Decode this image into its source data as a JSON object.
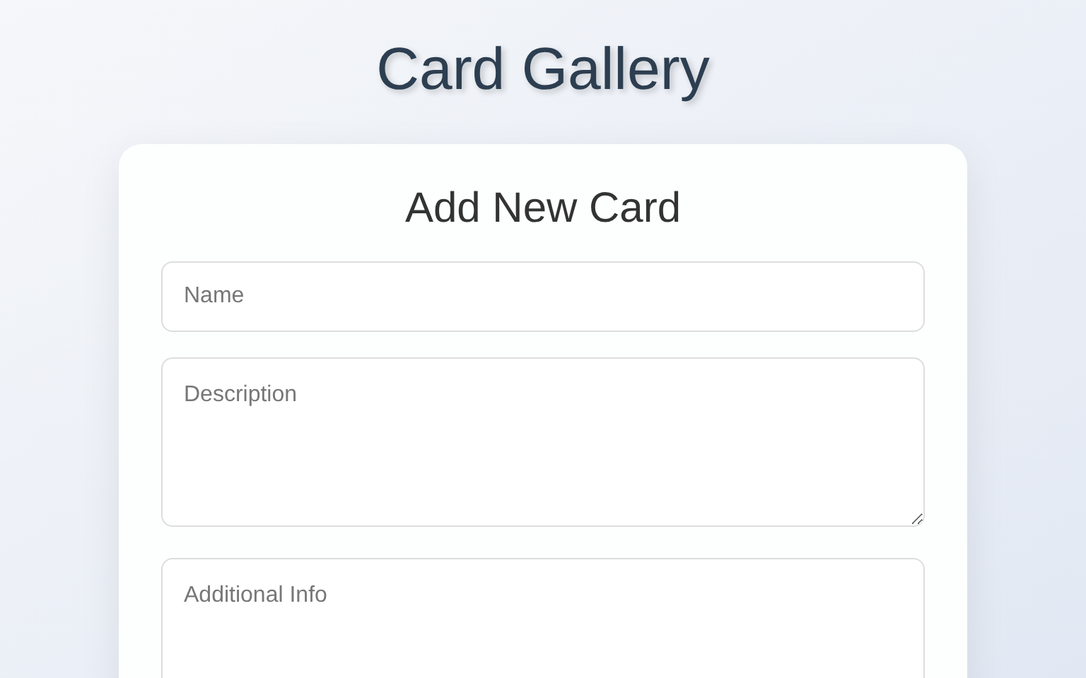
{
  "page_title": "Card Gallery",
  "form": {
    "title": "Add New Card",
    "fields": [
      {
        "kind": "input",
        "placeholder": "Name"
      },
      {
        "kind": "textarea",
        "placeholder": "Description"
      },
      {
        "kind": "textarea",
        "placeholder": "Additional Info"
      }
    ]
  }
}
